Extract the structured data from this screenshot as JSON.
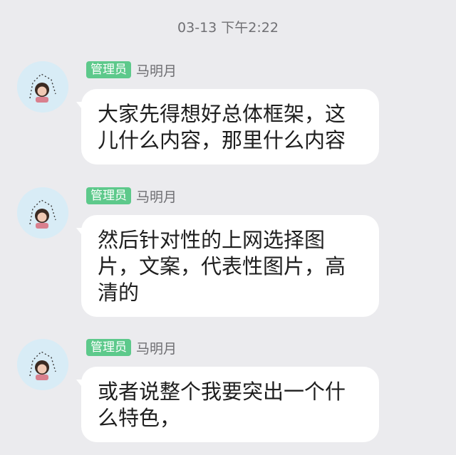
{
  "timestamp": "03-13 下午2:22",
  "messages": [
    {
      "role_badge": "管理员",
      "sender": "马明月",
      "text": "大家先得想好总体框架，这儿什么内容，那里什么内容"
    },
    {
      "role_badge": "管理员",
      "sender": "马明月",
      "text": "然后针对性的上网选择图片，文案，代表性图片，高清的"
    },
    {
      "role_badge": "管理员",
      "sender": "马明月",
      "text": "或者说整个我要突出一个什么特色，"
    }
  ],
  "colors": {
    "background": "#ebebee",
    "bubble": "#ffffff",
    "badge": "#5dc98b",
    "meta_text": "#6f6f73"
  },
  "icons": [
    "avatar-photo"
  ]
}
